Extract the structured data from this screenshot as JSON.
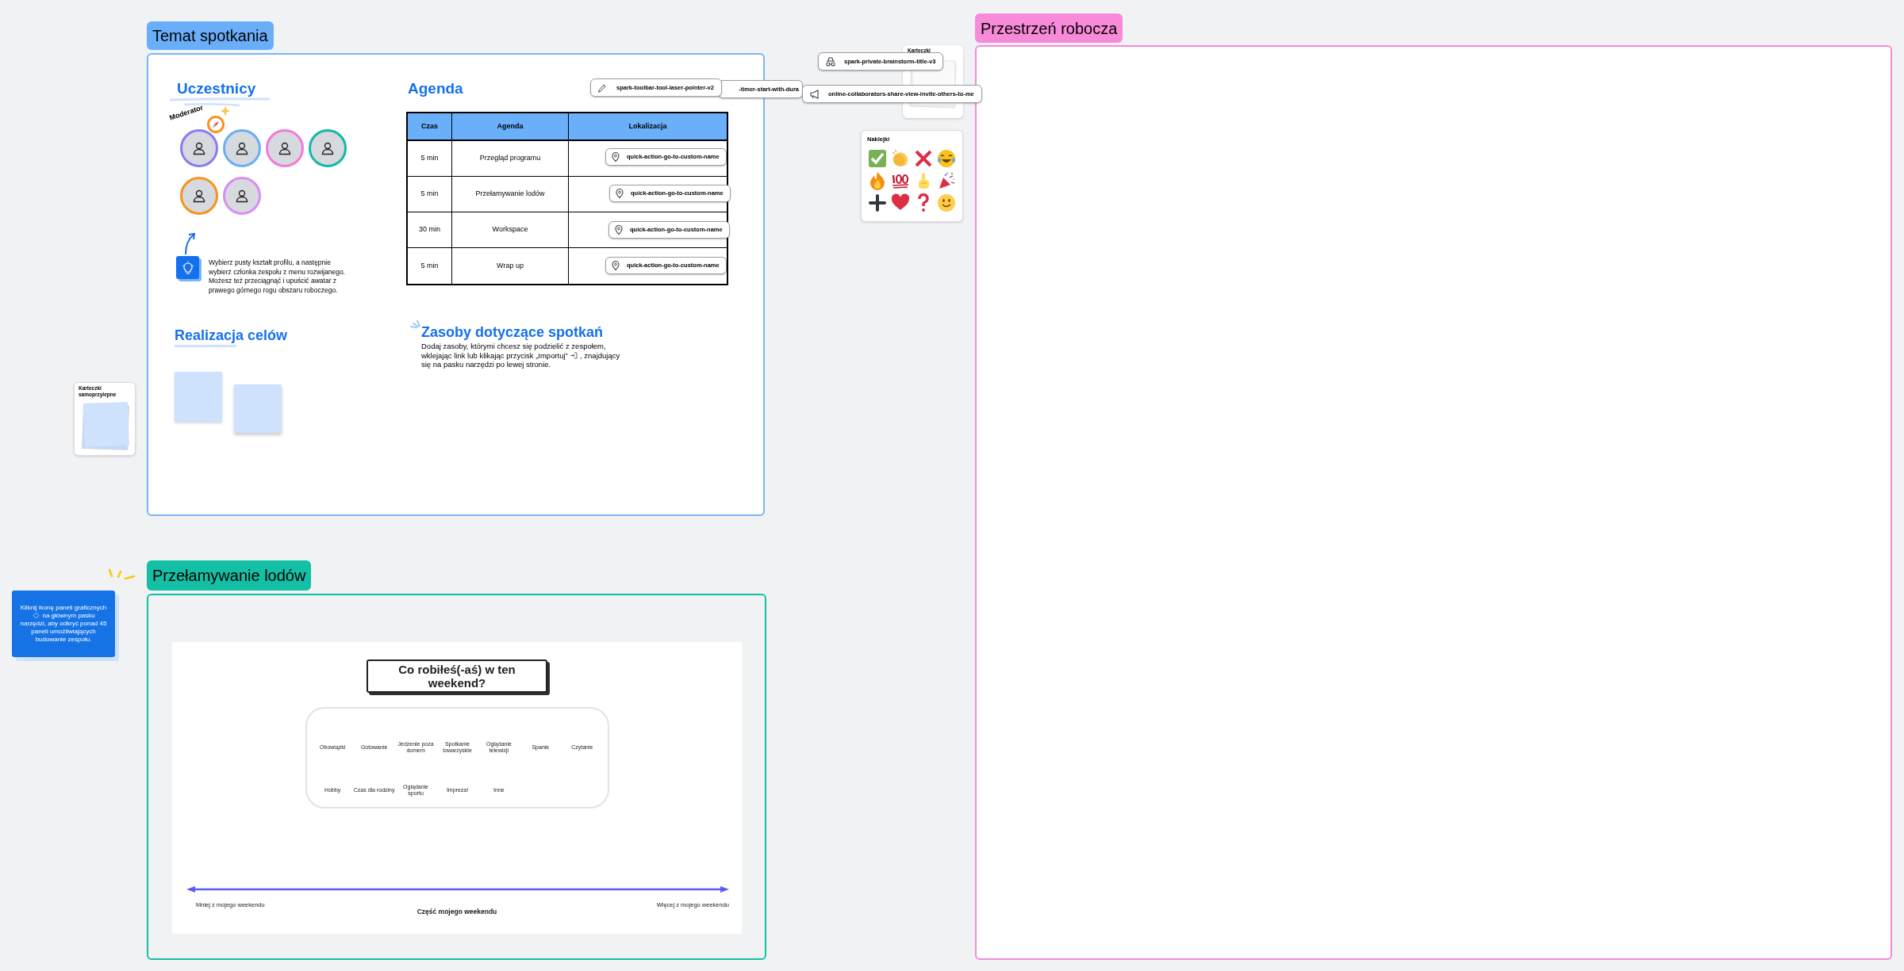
{
  "meeting_frame": {
    "label": "Temat spotkania",
    "participants": {
      "heading": "Uczestnicy",
      "moderator_label": "Moderator",
      "avatars": [
        {
          "color": "#8b7cf0",
          "moderator": true
        },
        {
          "color": "#6aaef5",
          "moderator": false
        },
        {
          "color": "#f27ad8",
          "moderator": false
        },
        {
          "color": "#14b8a6",
          "moderator": false
        },
        {
          "color": "#f7931e",
          "moderator": false
        },
        {
          "color": "#d98ef5",
          "moderator": false
        }
      ],
      "hint": "Wybierz pusty kształt profilu, a następnie wybierz członka zespołu z menu rozwijanego. Możesz też przeciągnąć i upuścić awatar z prawego górnego rogu obszaru roboczego."
    },
    "agenda": {
      "heading": "Agenda",
      "columns": [
        "Czas",
        "Agenda",
        "Lokalizacja"
      ],
      "rows": [
        {
          "time": "5 min",
          "item": "Przegląd programu",
          "link": "quick-action-go-to-custom-name"
        },
        {
          "time": "5 min",
          "item": "Przełamywanie lodów",
          "link": "quick-action-go-to-custom-name"
        },
        {
          "time": "30 min",
          "item": "Workspace",
          "link": "quick-action-go-to-custom-name"
        },
        {
          "time": "5 min",
          "item": "Wrap up",
          "link": "quick-action-go-to-custom-name"
        }
      ]
    },
    "goals": {
      "heading": "Realizacja celów"
    },
    "resources": {
      "heading": "Zasoby dotyczące spotkań",
      "text_before": "Dodaj zasoby, którymi chcesz się podzielić z zespołem, wklejając link lub klikając przycisk „Importuj”",
      "text_after": ", znajdujący się na pasku narzędzi po lewej stronie."
    }
  },
  "floating_chips": [
    {
      "kind": "pencil",
      "label": "spark-toolbar-tool-laser-pointer-v2"
    },
    {
      "kind": "plain",
      "label": "-timer-start-with-dura"
    },
    {
      "kind": "incognito",
      "label": "spark-private-brainstorm-title-v3"
    },
    {
      "kind": "megaphone",
      "label": "online-collaborators-share-view-invite-others-to-me"
    }
  ],
  "widgets": {
    "cards_title": "Karteczki",
    "stickers_title": "Naklejki",
    "sticky_pad_title": "Karteczki samoprzylepne"
  },
  "tip_note": {
    "text_before": "Kliknij ikonę paneli graficznych",
    "text_after": "na głównym pasku narzędzi, aby odkryć ponad 45 paneli umożliwiających budowanie zespołu."
  },
  "icebreaker_frame": {
    "label": "Przełamywanie lodów",
    "question": "Co robiłeś(-aś) w ten weekend?",
    "options": [
      "Obowiązki",
      "Gotowanie",
      "Jedzenie poza domem",
      "Spotkanie towarzyskie",
      "Oglądanie telewizji",
      "Spanie",
      "Czytanie",
      "Hobby",
      "Czas dla rodziny",
      "Oglądanie sportu",
      "Impreza!",
      "Inne"
    ],
    "scale": {
      "left": "Mniej z mojego weekendu",
      "center": "Część mojego weekendu",
      "right": "Więcej z mojego weekendu"
    }
  },
  "workspace_frame": {
    "label": "Przestrzeń robocza"
  }
}
